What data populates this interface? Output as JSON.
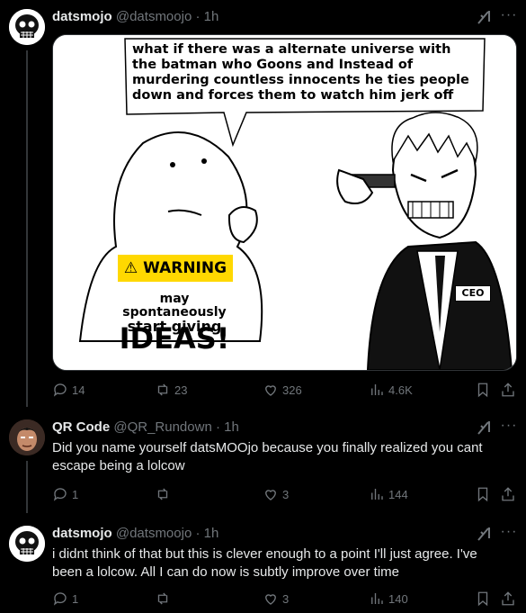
{
  "posts": [
    {
      "author": "datsmojo",
      "handle": "@datsmoojo",
      "time": "· 1h",
      "media": {
        "speech": "what if there was a alternate universe with the batman who Goons and Instead of murdering countless innocents he ties people down and forces them to watch him jerk off",
        "warning_label": "WARNING",
        "warning_line1": "may spontaneously",
        "warning_line2": "start giving",
        "warning_big": "IDEAS!",
        "ceo_label": "CEO"
      },
      "stats": {
        "replies": "14",
        "reposts": "23",
        "likes": "326",
        "views": "4.6K"
      }
    },
    {
      "author": "QR Code",
      "handle": "@QR_Rundown",
      "time": "· 1h",
      "text": "Did you name yourself datsMOOjo because you finally realized you cant escape being a lolcow",
      "stats": {
        "replies": "1",
        "reposts": "",
        "likes": "3",
        "views": "144"
      }
    },
    {
      "author": "datsmojo",
      "handle": "@datsmoojo",
      "time": "· 1h",
      "text": "i didnt think of that but this is clever enough to a point I'll just agree. I've been a lolcow. All I can do now is subtly improve over time",
      "stats": {
        "replies": "1",
        "reposts": "",
        "likes": "3",
        "views": "140"
      }
    }
  ],
  "icons": {
    "reply": "reply-icon",
    "repost": "repost-icon",
    "like": "heart-icon",
    "views": "views-icon",
    "bookmark": "bookmark-icon",
    "share": "share-icon",
    "grok": "grok-icon",
    "more": "more-icon"
  },
  "colors": {
    "background": "#000000",
    "text": "#e7e9ea",
    "muted": "#71767b",
    "warning": "#ffd800"
  }
}
